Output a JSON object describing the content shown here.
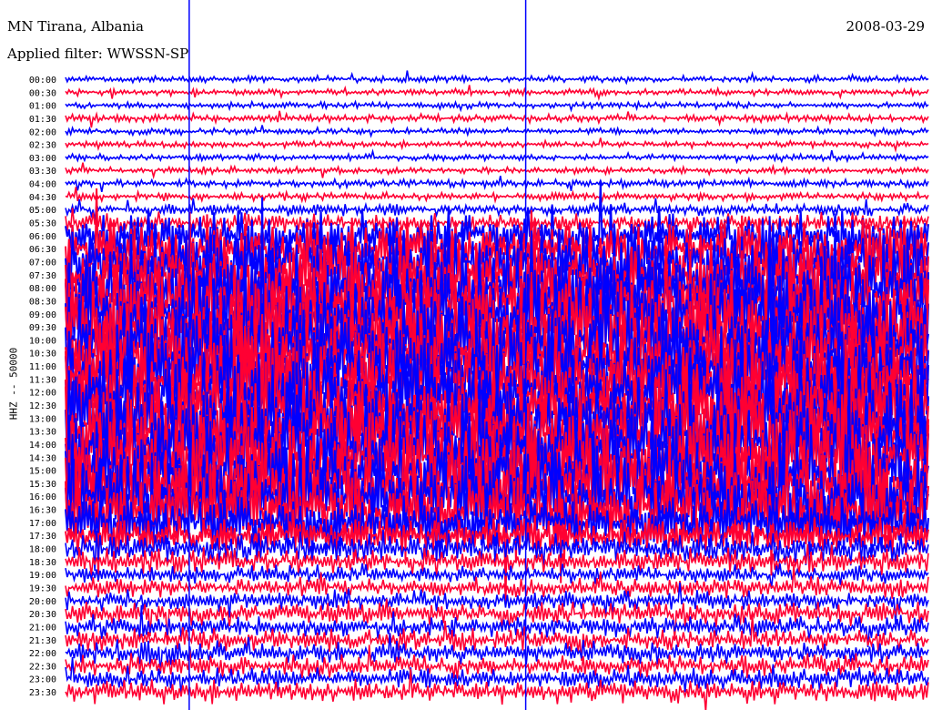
{
  "header": {
    "station": "MN Tirana, Albania",
    "filter": "Applied filter: WWSSN-SP",
    "date": "2008-03-29"
  },
  "chart_data": {
    "type": "line",
    "title": "MN Tirana, Albania",
    "subtitle": "Applied filter: WWSSN-SP",
    "date": "2008-03-29",
    "ylabel": "HHZ -- 50000",
    "xlabel": "",
    "minutes_per_row": 30,
    "colors": [
      "#0000ff",
      "#ff0033"
    ],
    "row_labels": [
      "00:00",
      "00:30",
      "01:00",
      "01:30",
      "02:00",
      "02:30",
      "03:00",
      "03:30",
      "04:00",
      "04:30",
      "05:00",
      "05:30",
      "06:00",
      "06:30",
      "07:00",
      "07:30",
      "08:00",
      "08:30",
      "09:00",
      "09:30",
      "10:00",
      "10:30",
      "11:00",
      "11:30",
      "12:00",
      "12:30",
      "13:00",
      "13:30",
      "14:00",
      "14:30",
      "15:00",
      "15:30",
      "16:00",
      "16:30",
      "17:00",
      "17:30",
      "18:00",
      "18:30",
      "19:00",
      "19:30",
      "20:00",
      "20:30",
      "21:00",
      "21:30",
      "22:00",
      "22:30",
      "23:00",
      "23:30"
    ],
    "relative_amplitude": [
      1,
      1,
      1,
      1.2,
      1,
      1,
      1,
      1.1,
      1.2,
      1.3,
      1.8,
      3,
      8,
      10,
      12,
      14,
      16,
      16,
      16,
      16,
      16,
      16,
      16,
      16,
      16,
      16,
      16,
      16,
      16,
      16,
      16,
      16,
      16,
      14,
      10,
      6,
      5,
      4,
      3,
      3,
      3,
      3.5,
      3.5,
      3.5,
      3.5,
      3.5,
      3.5,
      3.5
    ],
    "spike_minutes": [
      4.3,
      16.0
    ]
  }
}
